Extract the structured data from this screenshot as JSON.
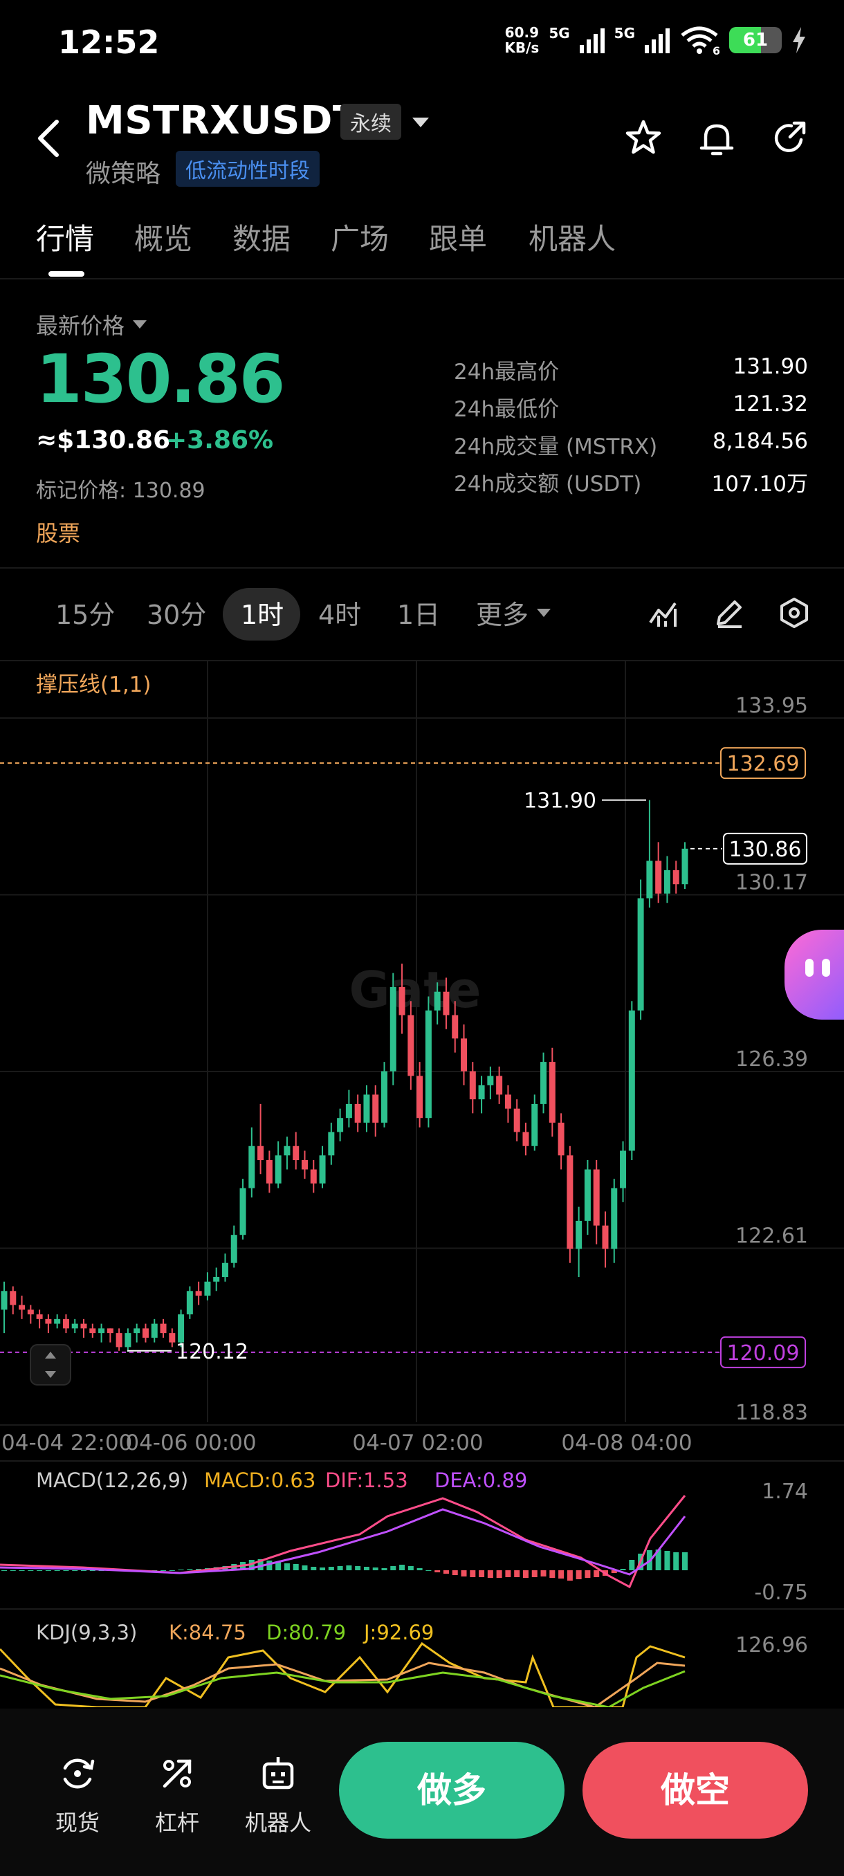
{
  "status_bar": {
    "time": "12:52",
    "net_speed_value": "60.9",
    "net_speed_unit": "KB/s",
    "signal1": "5G",
    "signal2": "5G",
    "wifi": "6",
    "battery": "61",
    "battery_level_pct": 61
  },
  "header": {
    "pair": "MSTRXUSDT",
    "contract_tag": "永续",
    "sub_name": "微策略",
    "liquidity_tag": "低流动性时段"
  },
  "tabs": [
    "行情",
    "概览",
    "数据",
    "广场",
    "跟单",
    "机器人"
  ],
  "price_panel": {
    "latest_label": "最新价格",
    "last_price": "130.86",
    "usd_price": "≈$130.86",
    "change_pct": "+3.86%",
    "mark_price": "标记价格: 130.89",
    "category": "股票",
    "stats": [
      {
        "label": "24h最高价",
        "value": "131.90"
      },
      {
        "label": "24h最低价",
        "value": "121.32"
      },
      {
        "label": "24h成交量 (MSTRX)",
        "value": "8,184.56"
      },
      {
        "label": "24h成交额 (USDT)",
        "value": "107.10万"
      }
    ]
  },
  "timeframes": [
    "15分",
    "30分",
    "1时",
    "4时",
    "1日"
  ],
  "timeframe_selected": "1时",
  "more_label": "更多",
  "chart": {
    "indicator_label": "撑压线(1,1)",
    "resistance": "132.69",
    "support": "120.09",
    "current_price": "130.86",
    "high_marker": "131.90",
    "low_marker": "120.12",
    "y_ticks": [
      "133.95",
      "130.17",
      "126.39",
      "122.61",
      "118.83"
    ],
    "x_ticks": [
      "04-04 22:00",
      "04-06 00:00",
      "04-07 02:00",
      "04-08 04:00"
    ],
    "watermark": "Gate",
    "colors": {
      "up": "#2dc08e",
      "down": "#f0505e",
      "resistance": "#f0a65a",
      "support": "#c040e0"
    }
  },
  "macd": {
    "title": "MACD(12,26,9)",
    "macd": "MACD:0.63",
    "dif": "DIF:1.53",
    "dea": "DEA:0.89",
    "y_top": "1.74",
    "y_bottom": "-0.75"
  },
  "kdj": {
    "title": "KDJ(9,3,3)",
    "k": "K:84.75",
    "d": "D:80.79",
    "j": "J:92.69",
    "y_top": "126.96"
  },
  "bottom_nav": [
    {
      "label": "现货",
      "icon": "spot-exchange-icon"
    },
    {
      "label": "杠杆",
      "icon": "leverage-icon"
    },
    {
      "label": "机器人",
      "icon": "robot-icon"
    }
  ],
  "buy_label": "做多",
  "sell_label": "做空"
}
